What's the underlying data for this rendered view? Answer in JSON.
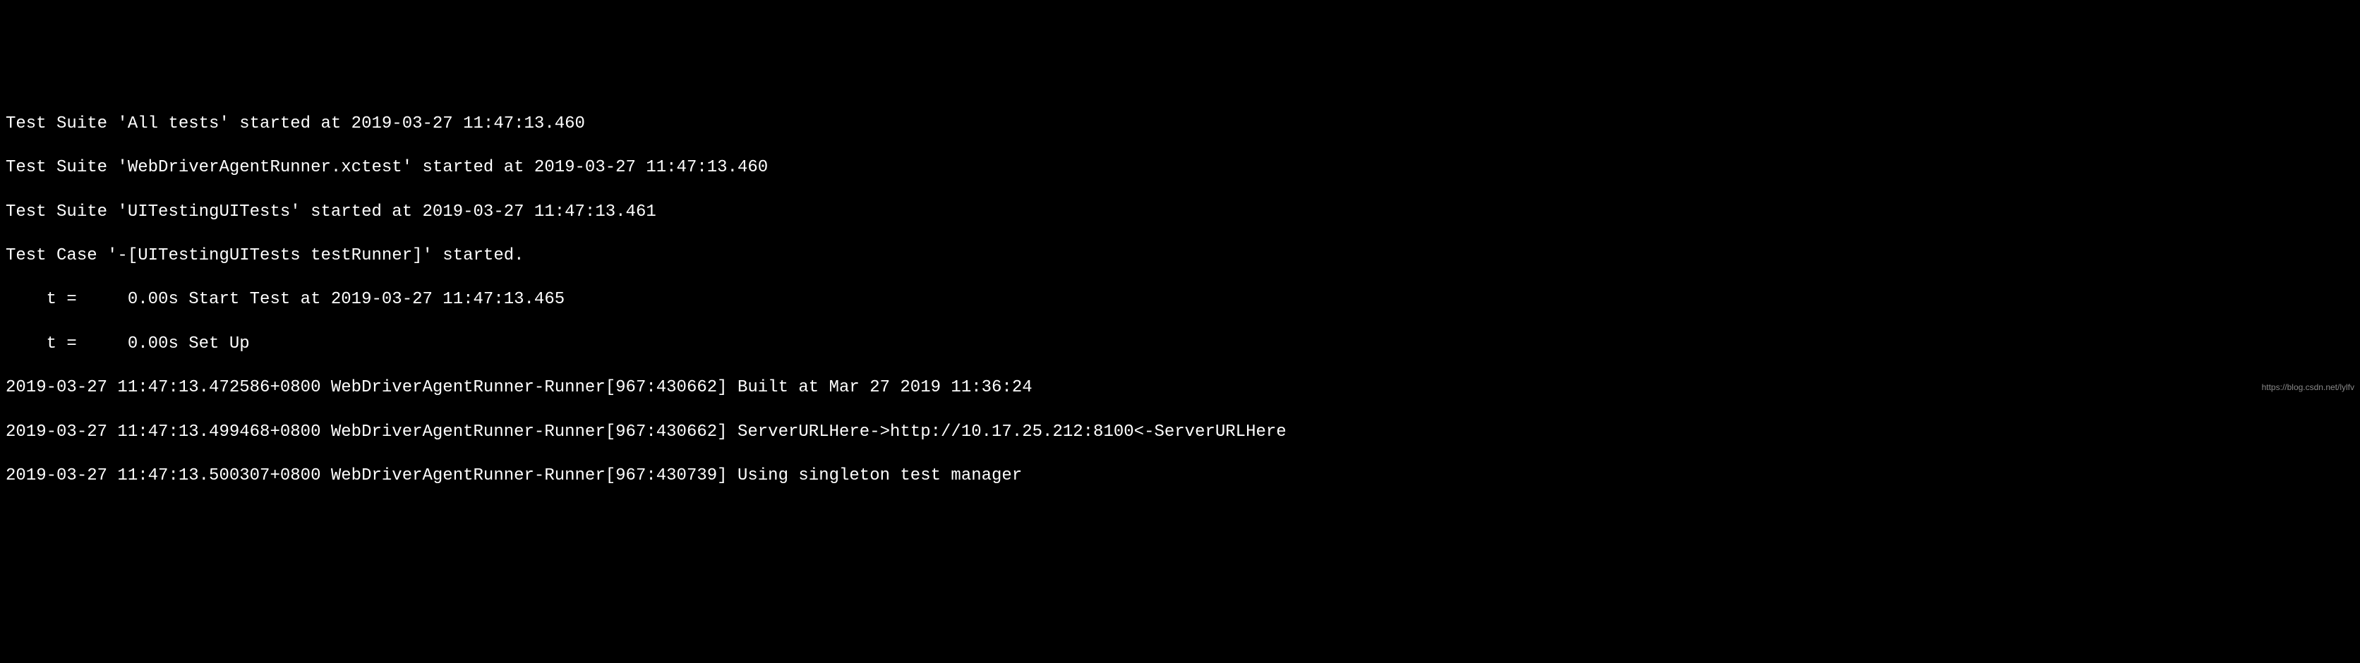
{
  "log": {
    "lines": [
      "Test Suite 'All tests' started at 2019-03-27 11:47:13.460",
      "Test Suite 'WebDriverAgentRunner.xctest' started at 2019-03-27 11:47:13.460",
      "Test Suite 'UITestingUITests' started at 2019-03-27 11:47:13.461",
      "Test Case '-[UITestingUITests testRunner]' started.",
      "    t =     0.00s Start Test at 2019-03-27 11:47:13.465",
      "    t =     0.00s Set Up",
      "2019-03-27 11:47:13.472586+0800 WebDriverAgentRunner-Runner[967:430662] Built at Mar 27 2019 11:36:24",
      "2019-03-27 11:47:13.499468+0800 WebDriverAgentRunner-Runner[967:430662] ServerURLHere->http://10.17.25.212:8100<-ServerURLHere",
      "2019-03-27 11:47:13.500307+0800 WebDriverAgentRunner-Runner[967:430739] Using singleton test manager"
    ]
  },
  "watermark": "https://blog.csdn.net/lylfv"
}
